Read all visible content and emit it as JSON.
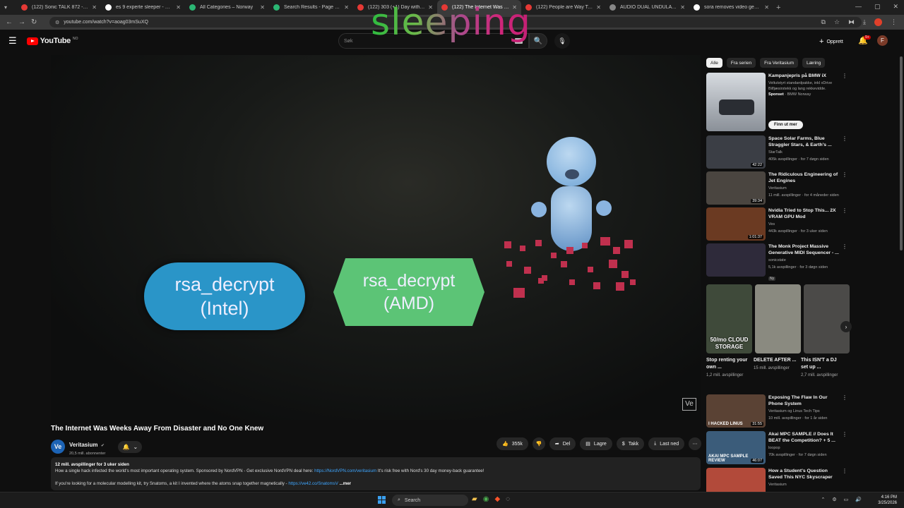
{
  "browser": {
    "tabs": [
      {
        "title": "(122) Sonic TALK 872 - Nadia",
        "color": "#e53935",
        "active": false
      },
      {
        "title": "es 9 experte sleeper - Google",
        "color": "#ffffff",
        "active": false
      },
      {
        "title": "All Categories – Norway",
        "color": "#2bb673",
        "active": false
      },
      {
        "title": "Search Results - Page 1 - \"dual",
        "color": "#2bb673",
        "active": false
      },
      {
        "title": "(122) 303 (+1) Day with the DJ",
        "color": "#e53935",
        "active": false
      },
      {
        "title": "(122) The Internet Was Wee",
        "color": "#e53935",
        "active": true
      },
      {
        "title": "(122) People are Way Too Crea",
        "color": "#e53935",
        "active": false
      },
      {
        "title": "AUDIO DUAL UNDULA OSCILL",
        "color": "#888888",
        "active": false
      },
      {
        "title": "sora removes video generating",
        "color": "#ffffff",
        "active": false
      }
    ],
    "url": "youtube.com/watch?v=aoag03mSuXQ"
  },
  "overlay_word": "sleeping",
  "youtube": {
    "logo_text": "YouTube",
    "logo_country": "NO",
    "search_placeholder": "Søk",
    "create_label": "Opprett",
    "notif_count": "9+",
    "avatar_letter": "F"
  },
  "player": {
    "pill_line1": "rsa_decrypt",
    "pill_line2": "(Intel)",
    "hex_line1": "rsa_decrypt",
    "hex_line2": "(AMD)",
    "watermark": "Ve"
  },
  "video": {
    "title": "The Internet Was Weeks Away From Disaster and No One Knew",
    "channel_name": "Veritasium",
    "channel_initials": "Ve",
    "subscribers": "20,5 mill. abonnenter",
    "likes": "355k",
    "share_label": "Del",
    "save_label": "Lagre",
    "thanks_label": "Takk",
    "download_label": "Last ned",
    "desc_meta": "12 mill. avspillinger  for 3 uker siden",
    "desc_line1_pre": "How a single hack infected the world's most important operating system. Sponsored by NordVPN - Get exclusive NordVPN deal here: ",
    "desc_line1_link": "https://NordVPN.com/veritasium",
    "desc_line1_post": " It's risk free with Nord's 30 day money-back guarantee!",
    "desc_line2_pre": "If you're looking for a molecular modelling kit, try Snatoms, a kit I invented where the atoms snap together magnetically - ",
    "desc_line2_link": "https://ve42.co/SnatomsV",
    "desc_more": "...mer"
  },
  "sidebar": {
    "chips": [
      "Alle",
      "Fra serien",
      "Fra Veritasium",
      "Læring"
    ],
    "ad": {
      "title": "Kampanjepris på BMW iX",
      "sub1": "Veltutstyrt standardpakke, inkl xDrive",
      "sub2": "Bilfjæsirstekk og lang rekkevidde.",
      "sponsor_label": "Sponset",
      "advertiser": "BMW Norway",
      "cta": "Finn ut mer"
    },
    "items": [
      {
        "title": "Space Solar Farms, Blue Straggler Stars, & Earth's ...",
        "channel": "StarTalk",
        "meta": "405k avspillinger · for 7 døgn siden",
        "duration": "42:22",
        "thumb": "#3b3e45"
      },
      {
        "title": "The Ridiculous Engineering of Jet Engines",
        "channel": "Veritasium",
        "meta": "11 mill. avspillinger · for 4 måneder siden",
        "duration": "39:34",
        "thumb": "#4a4540"
      },
      {
        "title": "Nvidia Tried to Stop This... 2X VRAM GPU Mod",
        "channel": "Ves",
        "meta": "443k avspillinger · for 3 uker siden",
        "duration": "1:01:37",
        "thumb": "#6b3a22"
      },
      {
        "title": "The Monk Project Massive Generative MIDI Sequencer - ...",
        "channel": "sonicstate",
        "meta": "5,1k avspillinger · for 3 døgn siden",
        "duration": "",
        "thumb": "#2e2a3a",
        "new_badge": "Ny"
      }
    ],
    "shorts": [
      {
        "caption": "50/mo CLOUD STORAGE",
        "title": "Stop renting your own ...",
        "views": "1,2 mill. avspillinger",
        "thumb": "#3f4a3a"
      },
      {
        "caption": "",
        "title": "DELETE AFTER ...",
        "views": "15 mill. avspillinger",
        "thumb": "#8a8a80"
      },
      {
        "caption": "",
        "title": "This ISN'T a DJ set up ...",
        "views": "2,7 mill. avspillinger",
        "thumb": "#4b4a48"
      }
    ],
    "items2": [
      {
        "title": "Exposing The Flaw In Our Phone System",
        "channel": "Veritasium og Linus Tech Tips",
        "meta": "10 mill. avspillinger · for 1 år siden",
        "duration": "31:55",
        "thumb": "#5a4234",
        "thumb_text": "I HACKED LINUS"
      },
      {
        "title": "Akai MPC SAMPLE // Does It BEAT the Competition? + 5 ...",
        "channel": "loopop",
        "meta": "70k avspillinger · for 7 døgn siden",
        "duration": "46:07",
        "thumb": "#3b5c7a",
        "thumb_text": "AKAI MPC SAMPLE  REVIEW"
      },
      {
        "title": "How a Student's Question Saved This NYC Skyscraper",
        "channel": "Veritasium",
        "meta": "",
        "duration": "",
        "thumb": "#b24a3a",
        "thumb_text": ""
      }
    ]
  },
  "taskbar": {
    "search_label": "Search",
    "time": "4:16 PM",
    "date": "3/25/2026"
  }
}
